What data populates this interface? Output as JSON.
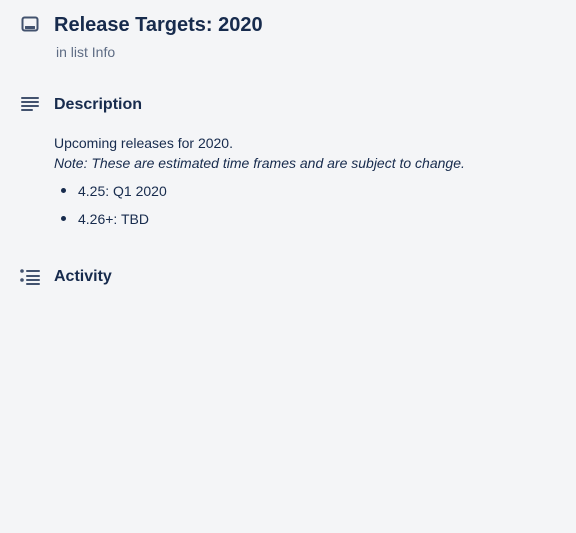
{
  "card": {
    "title": "Release Targets: 2020",
    "list_prefix": "in list",
    "list_name": "Info",
    "icons": {
      "card": "card-icon",
      "description": "description-icon",
      "activity": "activity-icon"
    }
  },
  "description": {
    "heading": "Description",
    "intro": "Upcoming releases for 2020.",
    "note": "Note: These are estimated time frames and are subject to change.",
    "releases": [
      "4.25: Q1 2020",
      "4.26+: TBD"
    ]
  },
  "activity": {
    "heading": "Activity"
  },
  "colors": {
    "background": "#f4f5f7",
    "text": "#172b4d",
    "muted": "#5e6c84",
    "icon": "#42526e"
  }
}
